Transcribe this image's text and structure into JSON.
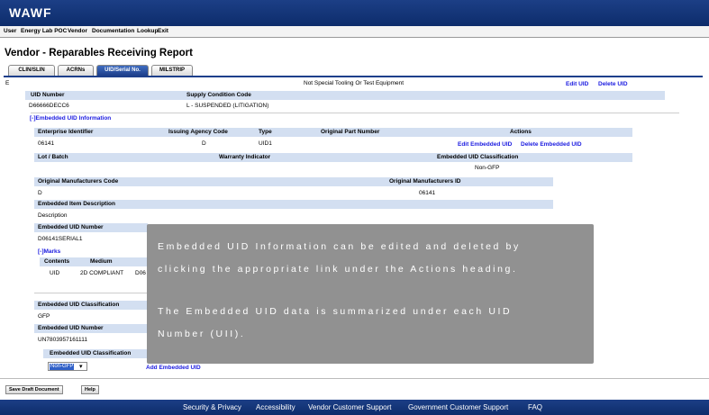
{
  "app_title": "WAWF",
  "menu": [
    "User",
    "Energy Lab POC",
    "Vendor",
    "Documentation",
    "Lookup",
    "Exit"
  ],
  "page_title": "Vendor - Reparables Receiving Report",
  "tabs": [
    "CLIN/SLIN",
    "ACRNs",
    "UID/Serial No.",
    "MILSTRIP"
  ],
  "top_row": {
    "left": "E",
    "tooling": "Not Special Tooling Or Test Equipment",
    "edit_uid": "Edit UID",
    "delete_uid": "Delete UID"
  },
  "uid_header": {
    "uid_number": "UID Number",
    "supply_condition": "Supply Condition Code"
  },
  "uid_row": {
    "uid_number": "D66666DECC6",
    "supply_condition": "L - SUSPENDED (LITIGATION)"
  },
  "embedded_toggle": "[-]Embedded UID Information",
  "embedded_header": {
    "enterprise_id": "Enterprise Identifier",
    "issuing_agency": "Issuing Agency Code",
    "type": "Type",
    "orig_part": "Original Part Number",
    "actions": "Actions"
  },
  "embedded_row": {
    "enterprise_id": "06141",
    "issuing_agency": "D",
    "type": "UID1",
    "edit": "Edit Embedded UID",
    "delete": "Delete Embedded UID"
  },
  "lot_header": {
    "lot": "Lot / Batch",
    "warranty": "Warranty Indicator",
    "classification": "Embedded UID Classification"
  },
  "lot_row": {
    "classification": "Non-GFP"
  },
  "omc_header": {
    "omc": "Original Manufacturers Code",
    "omid": "Original Manufacturers ID"
  },
  "omc_row": {
    "omc": "D",
    "omid": "06141"
  },
  "desc_header": "Embedded Item Description",
  "desc_value": "Description",
  "emb_uid_number_header": "Embedded UID Number",
  "emb_uid_number_value": "D06141SERIAL1",
  "marks_toggle": "[-]Marks",
  "marks_header": {
    "contents": "Contents",
    "medium": "Medium"
  },
  "marks_row": {
    "contents": "UID",
    "medium": "2D COMPLIANT",
    "value": "D06"
  },
  "class2_header": "Embedded UID Classification",
  "class2_value": "GFP",
  "num2_header": "Embedded UID Number",
  "num2_value": "UN7803957161111",
  "class3_header": "Embedded UID Classification",
  "select_value": "Non-GFP",
  "add_embedded": "Add Embedded UID",
  "buttons": {
    "save": "Save Draft Document",
    "help": "Help"
  },
  "overlay": [
    "Embedded UID Information can be edited and deleted by",
    "clicking the appropriate link under the Actions heading.",
    "The Embedded UID data is summarized under each UID",
    "Number (UII)."
  ],
  "footer": [
    "Security & Privacy",
    "Accessibility",
    "Vendor Customer Support",
    "Government Customer Support",
    "FAQ"
  ],
  "colors": {
    "header": "#1c3f86",
    "table_header": "#d3dff1",
    "link": "#1a1ae0",
    "overlay": "#858585"
  }
}
